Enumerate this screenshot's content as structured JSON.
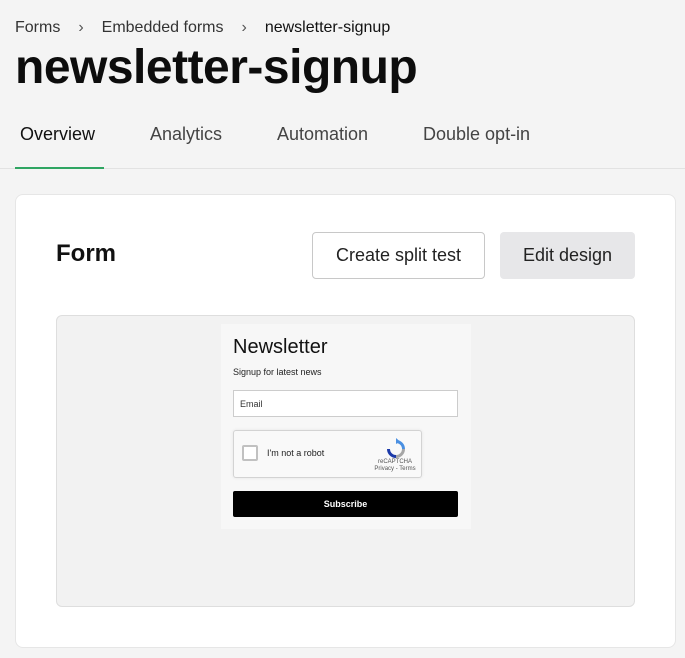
{
  "breadcrumb": {
    "items": [
      "Forms",
      "Embedded forms",
      "newsletter-signup"
    ],
    "separator": ">"
  },
  "page": {
    "title": "newsletter-signup"
  },
  "tabs": [
    {
      "label": "Overview",
      "active": true
    },
    {
      "label": "Analytics",
      "active": false
    },
    {
      "label": "Automation",
      "active": false
    },
    {
      "label": "Double opt-in",
      "active": false
    }
  ],
  "card": {
    "title": "Form",
    "split_test_label": "Create split test",
    "edit_design_label": "Edit design"
  },
  "embed_form": {
    "title": "Newsletter",
    "subtitle": "Signup for latest news",
    "email_placeholder": "Email",
    "captcha_label": "I'm not a robot",
    "captcha_brand": "reCAPTCHA",
    "captcha_links": "Privacy - Terms",
    "subscribe_label": "Subscribe"
  },
  "colors": {
    "accent_underline": "#2fa562",
    "subscribe_bg": "#000000",
    "edit_button_bg": "#e7e7e9"
  },
  "icons": {
    "breadcrumb_separator": "chevron-right-icon",
    "captcha_logo": "recaptcha-icon"
  }
}
